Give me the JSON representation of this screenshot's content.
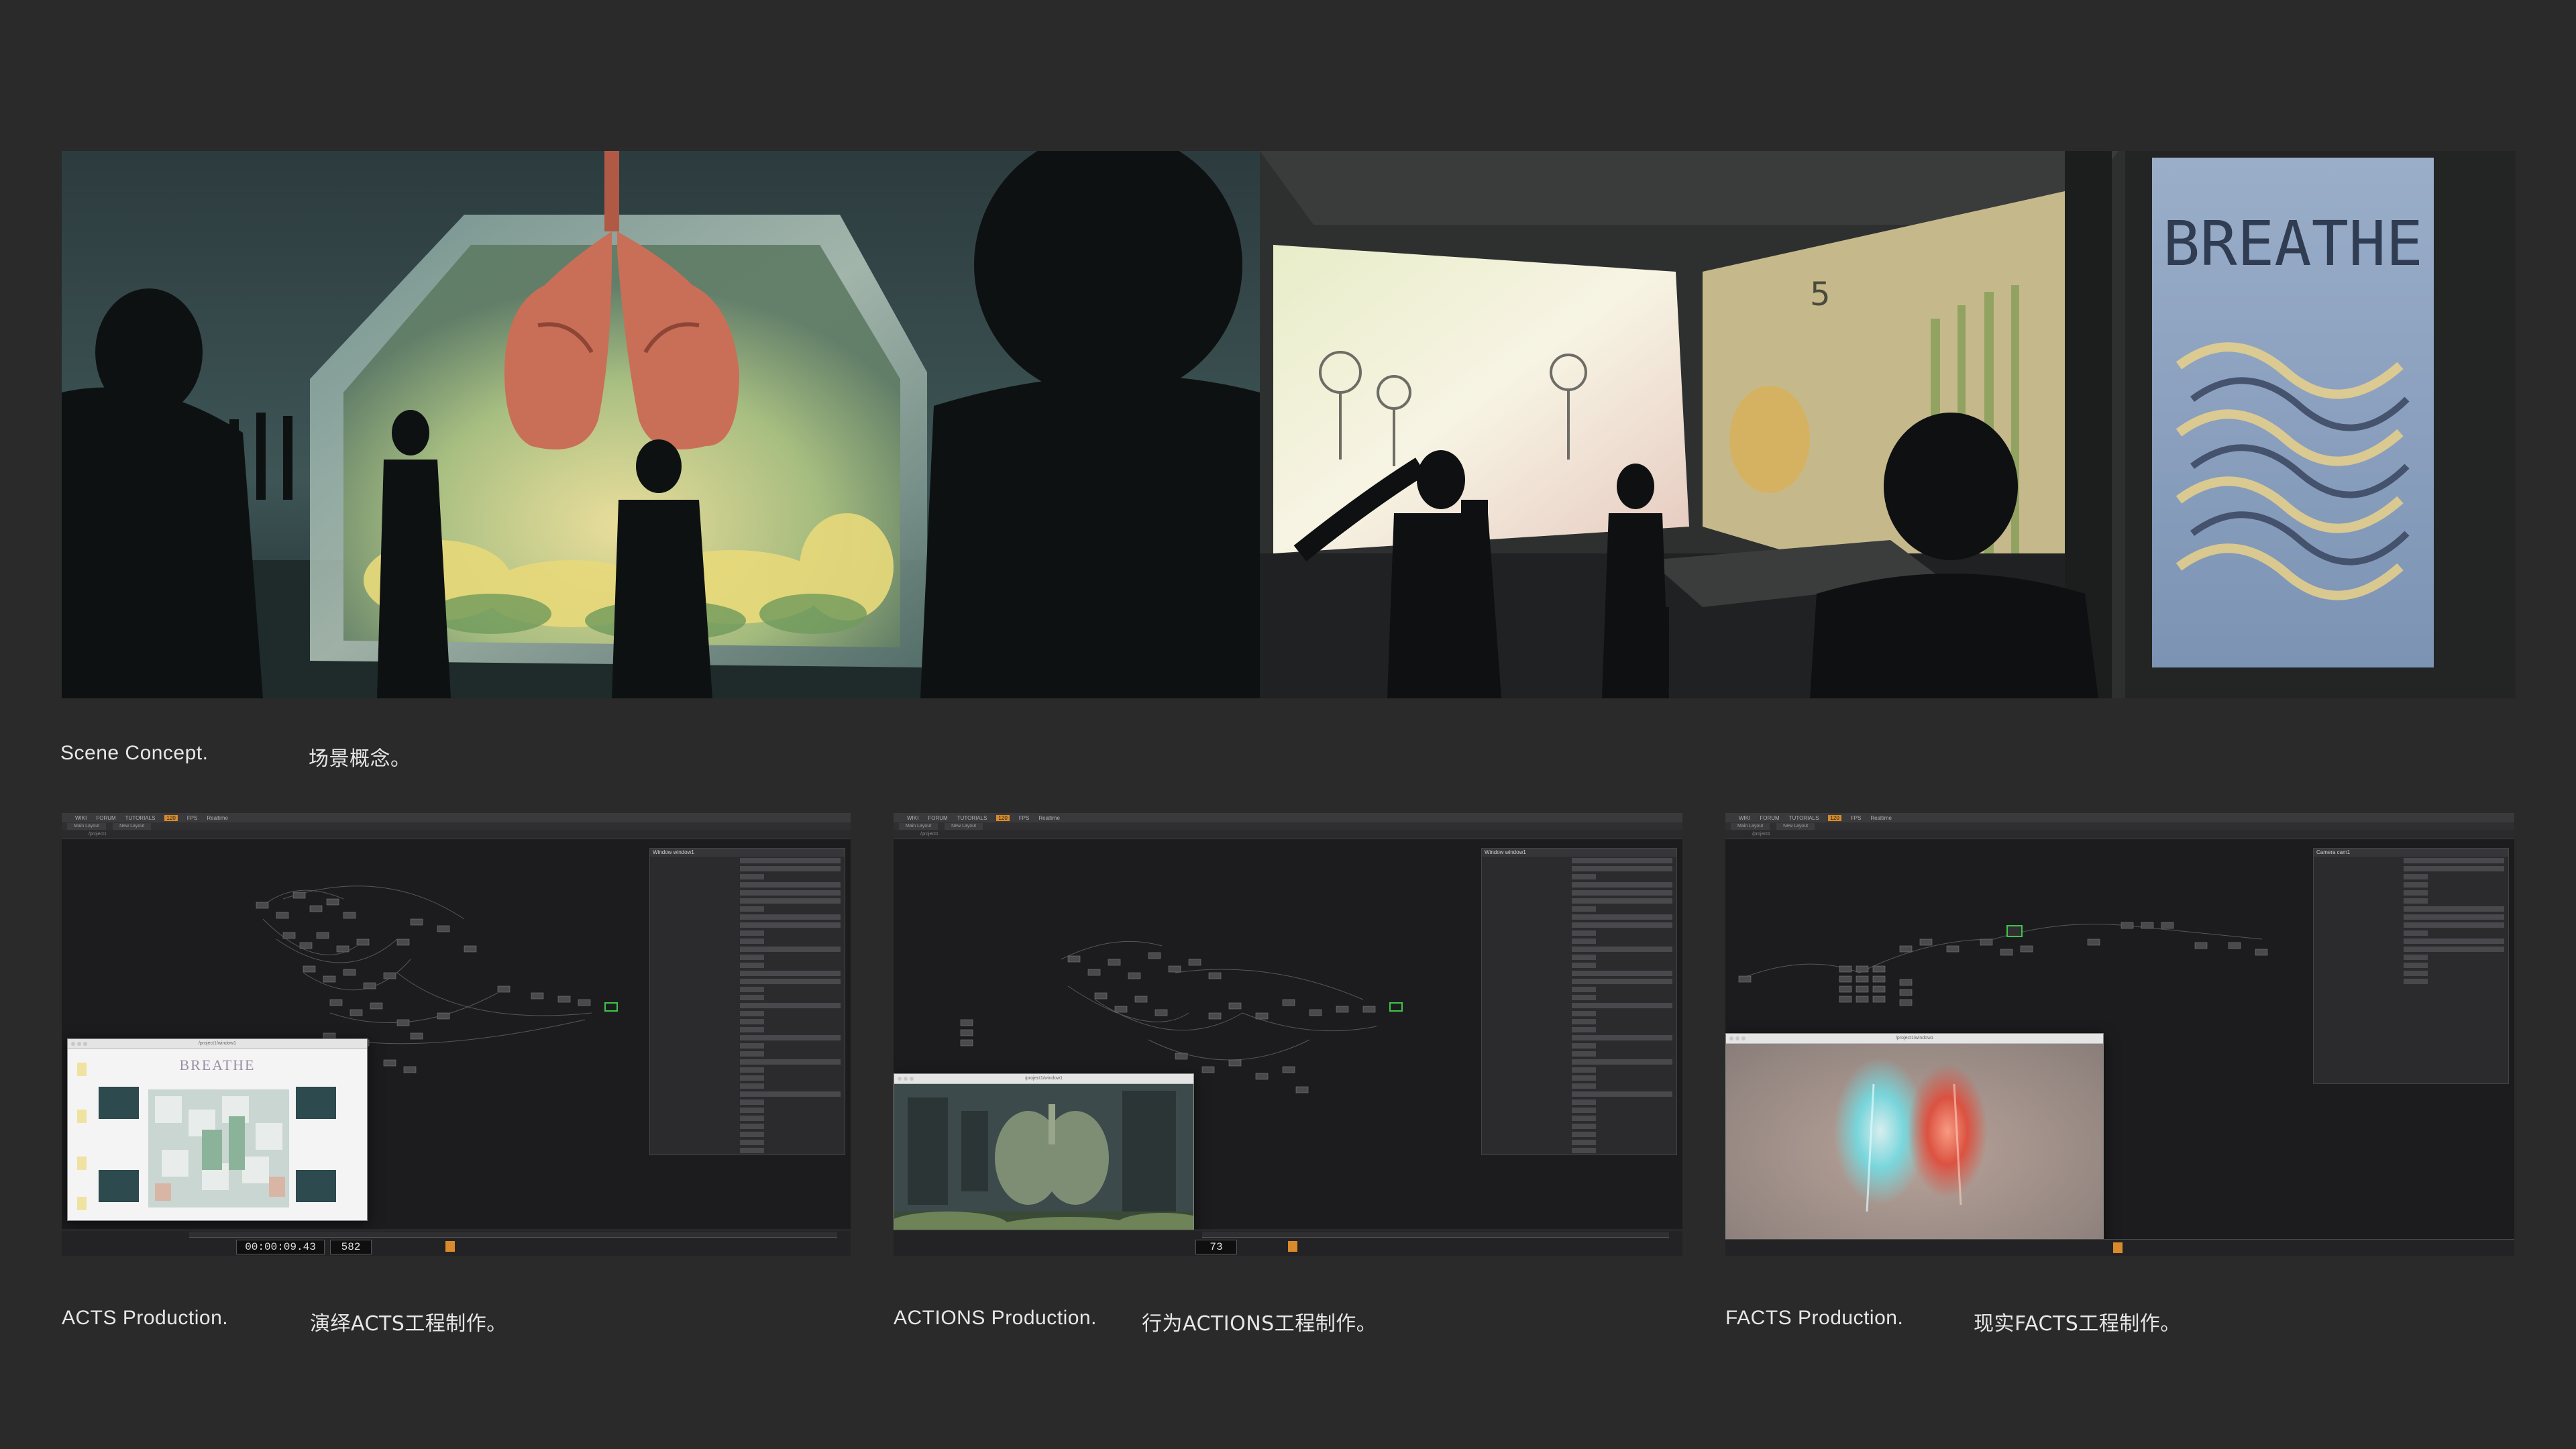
{
  "captions": {
    "scene": {
      "en": "Scene Concept.",
      "zh": "场景概念。"
    },
    "acts": {
      "en": "ACTS Production.",
      "zh": "演绎ACTS工程制作。"
    },
    "actions": {
      "en": "ACTIONS Production.",
      "zh": "行为ACTIONS工程制作。"
    },
    "facts": {
      "en": "FACTS Production.",
      "zh": "现实FACTS工程制作。"
    }
  },
  "concept": {
    "right_poster_text": "BREATHE",
    "right_sign_number": "5"
  },
  "apps": {
    "acts": {
      "menu": [
        "WIKI",
        "FORUM",
        "TUTORIALS",
        "FPS",
        "Realtime"
      ],
      "menu_accent": "120",
      "tabs": [
        "Main Layout",
        "New Layout"
      ],
      "path": "/project1",
      "params_title": "Window  window1",
      "preview_title": "/project1/window1",
      "preview_heading": "BREATHE",
      "timecode": "00:00:09.43",
      "frame": "582"
    },
    "actions": {
      "menu": [
        "WIKI",
        "FORUM",
        "TUTORIALS",
        "FPS",
        "Realtime"
      ],
      "menu_accent": "120",
      "tabs": [
        "Main Layout",
        "New Layout"
      ],
      "path": "/project1",
      "params_title": "Window  window1",
      "preview_title": "/project1/window1",
      "frame": "73"
    },
    "facts": {
      "menu": [
        "WIKI",
        "FORUM",
        "TUTORIALS",
        "FPS",
        "Realtime"
      ],
      "menu_accent": "120",
      "tabs": [
        "Main Layout",
        "New Layout"
      ],
      "path": "/project1",
      "params_title": "Camera  cam1",
      "preview_title": "/project1/window1"
    }
  },
  "colors": {
    "background": "#2a2a2a",
    "accent": "#d98a2b",
    "node_highlight": "#3fc44a"
  }
}
